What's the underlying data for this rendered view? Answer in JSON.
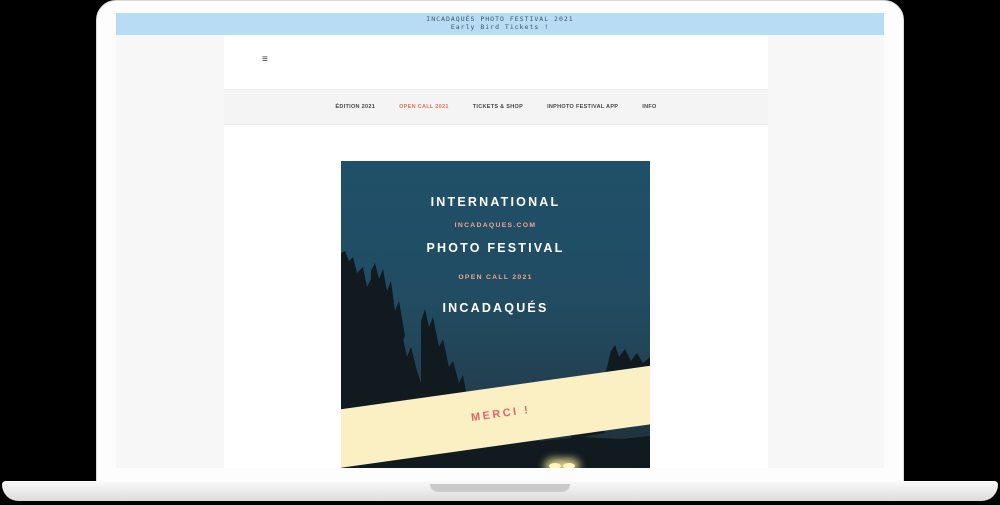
{
  "promo": {
    "line1": "INCADAQUÉS PHOTO FESTIVAL 2021",
    "line2": "Early Bird Tickets !"
  },
  "header": {
    "menu_icon": "hamburger-menu-icon",
    "menu_glyph": "≡"
  },
  "nav": {
    "active_color": "#e87058",
    "items": [
      {
        "label": "ÉDITION 2021",
        "active": false
      },
      {
        "label": "OPEN CALL 2021",
        "active": true
      },
      {
        "label": "TICKETS & SHOP",
        "active": false
      },
      {
        "label": "INPHOTO FESTIVAL APP",
        "active": false
      },
      {
        "label": "INFO",
        "active": false
      }
    ]
  },
  "hero": {
    "title_line1": "INTERNATIONAL",
    "website": "INCADAQUES.COM",
    "title_line2": "PHOTO FESTIVAL",
    "open_call": "OPEN CALL 2021",
    "title_line3": "INCADAQUÉS",
    "banner_text": "MERCI !"
  }
}
